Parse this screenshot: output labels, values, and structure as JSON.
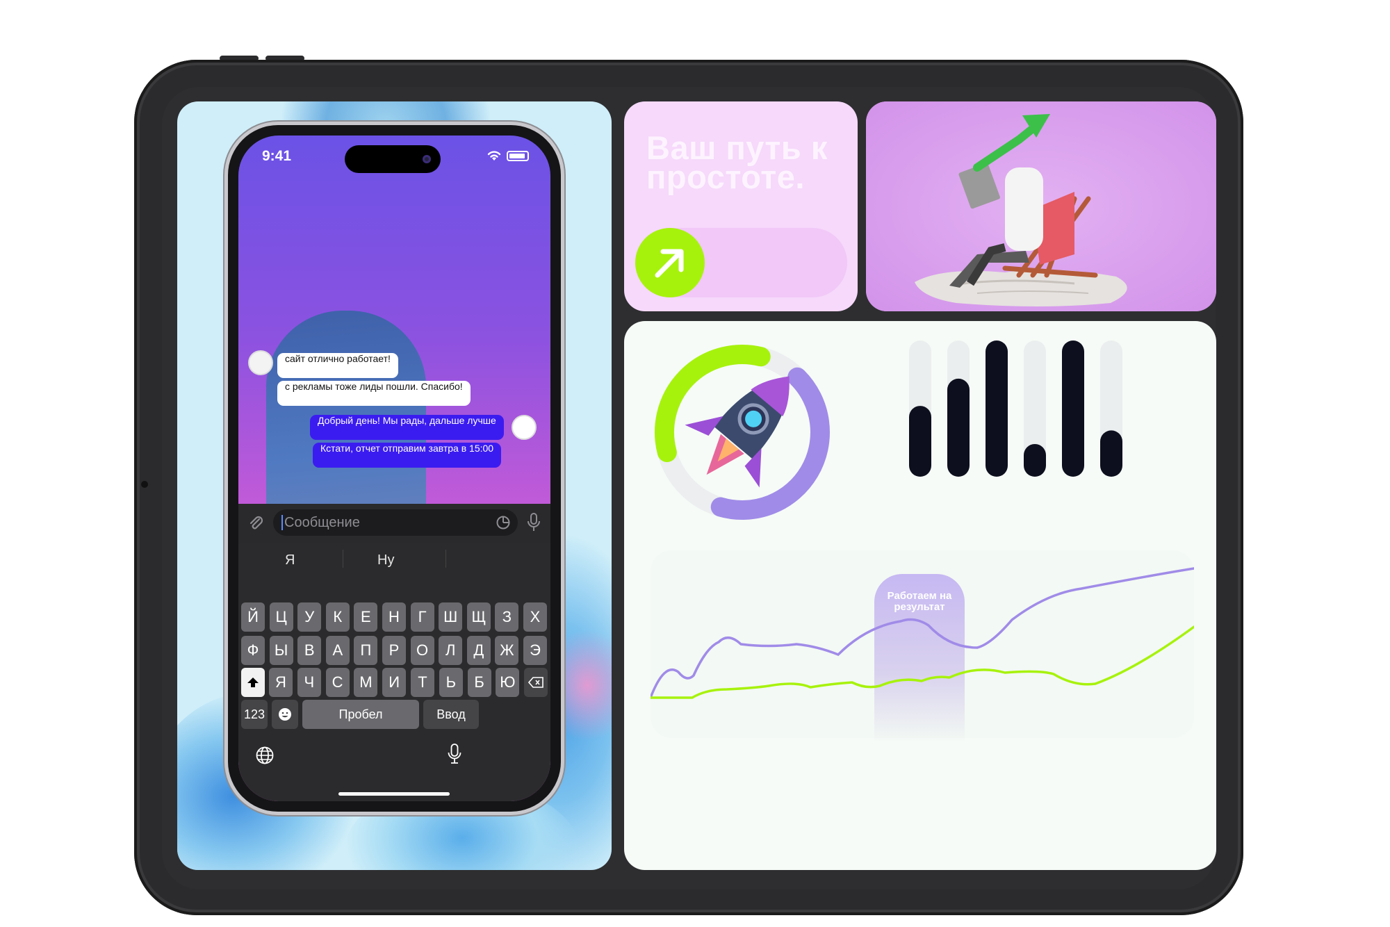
{
  "phone": {
    "status_time": "9:41",
    "chat": {
      "incoming": [
        "сайт отлично работает!",
        "с рекламы тоже лиды пошли. Спасибо!"
      ],
      "outgoing": [
        "Добрый день! Мы рады, дальше лучше",
        "Кстати, отчет отправим завтра в 15:00"
      ]
    },
    "input_placeholder": "Сообщение",
    "suggestions": [
      "Я",
      "Ну"
    ],
    "keyboard": {
      "row1": [
        "Й",
        "Ц",
        "У",
        "К",
        "Е",
        "Н",
        "Г",
        "Ш",
        "Щ",
        "З",
        "Х"
      ],
      "row2": [
        "Ф",
        "Ы",
        "В",
        "А",
        "П",
        "Р",
        "О",
        "Л",
        "Д",
        "Ж",
        "Э"
      ],
      "row3": [
        "Я",
        "Ч",
        "С",
        "М",
        "И",
        "Т",
        "Ь",
        "Б",
        "Ю"
      ],
      "numbers_label": "123",
      "space_label": "Пробел",
      "enter_label": "Ввод"
    },
    "icons": [
      "attach-icon",
      "sticker-icon",
      "mic-icon",
      "shift-icon",
      "backspace-icon",
      "emoji-icon",
      "globe-icon",
      "wifi-icon",
      "battery-icon"
    ]
  },
  "promo": {
    "headline": "Ваш путь к простоте.",
    "accent": "#a7f20d"
  },
  "dashboard": {
    "highlight_label": "Работаем на результат",
    "colors": {
      "purple": "#a08be8",
      "green": "#a7f20d",
      "bar_dark": "#0d0f1e",
      "bar_light": "#ebeeee"
    },
    "bars": [
      {
        "fill": 0.52
      },
      {
        "fill": 0.72
      },
      {
        "fill": 1.0
      },
      {
        "fill": 0.24
      },
      {
        "fill": 1.0
      },
      {
        "fill": 0.34
      }
    ],
    "progress_ring": {
      "green_share": 0.33,
      "purple_share": 0.42
    }
  }
}
